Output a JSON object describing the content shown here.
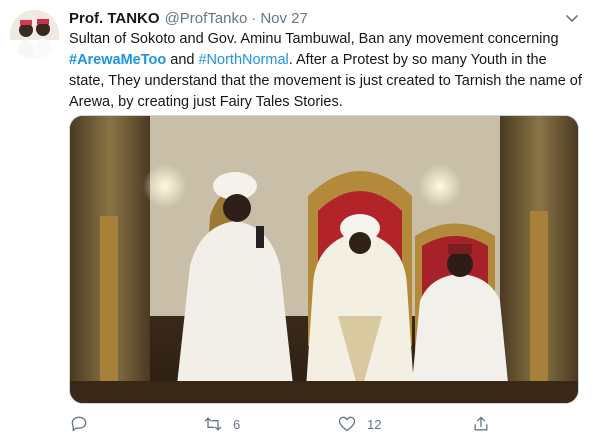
{
  "author": {
    "name": "Prof. TANKO",
    "handle": "@ProfTanko",
    "separator": "·",
    "date": "Nov 27"
  },
  "tweet": {
    "text_part1": "Sultan of Sokoto and Gov. Aminu Tambuwal, Ban any movement concerning ",
    "hashtag1": "#ArewaMeToo",
    "text_part2": " and ",
    "hashtag2": "#NorthNormal",
    "text_part3": ". After a Protest by so many Youth in the state, They understand that the movement is just created to Tarnish the name of Arewa, by creating just Fairy Tales Stories."
  },
  "actions": {
    "reply_count": "",
    "retweet_count": "6",
    "like_count": "12"
  },
  "icons": {
    "menu": "chevron-down-icon",
    "reply": "reply-icon",
    "retweet": "retweet-icon",
    "like": "heart-icon",
    "share": "share-icon"
  },
  "colors": {
    "link": "#1b95e0",
    "muted": "#657786",
    "text": "#14171a"
  }
}
